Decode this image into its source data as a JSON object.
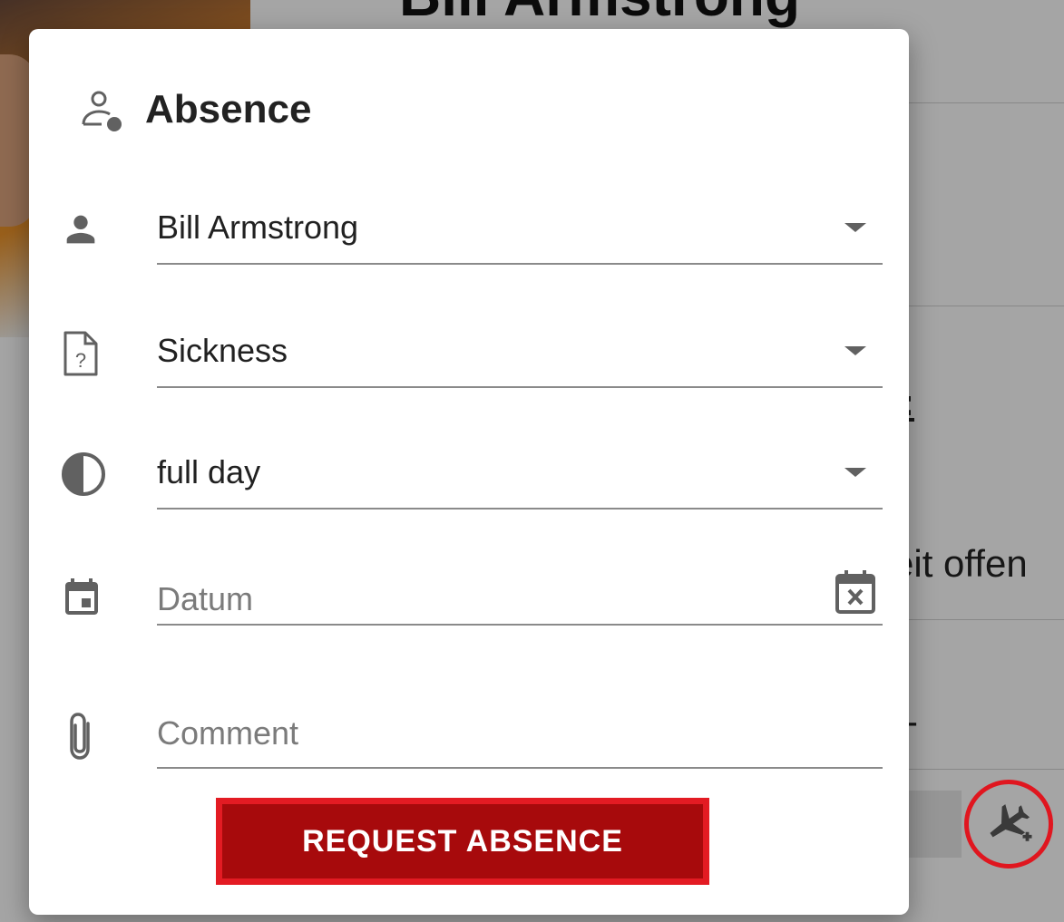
{
  "background": {
    "person_name": "Bill Armstrong",
    "partial_label_1": "t:",
    "partial_label_2": "t",
    "partial_label_3": "eit offen",
    "partial_label_4": "-"
  },
  "dialog": {
    "title": "Absence",
    "title_icon": "person-status-icon",
    "fields": {
      "employee": {
        "icon": "person-icon",
        "value": "Bill Armstrong"
      },
      "absence_type": {
        "icon": "file-question-icon",
        "value": "Sickness"
      },
      "duration": {
        "icon": "half-circle-icon",
        "value": "full day"
      },
      "date": {
        "icon": "calendar-icon",
        "placeholder": "Datum",
        "clear_icon": "calendar-clear-icon"
      },
      "comment": {
        "icon": "paperclip-icon",
        "placeholder": "Comment"
      }
    },
    "submit_label": "REQUEST ABSENCE"
  },
  "fab": {
    "icon": "airplane-add-icon"
  },
  "colors": {
    "button_bg": "#a70a0c",
    "button_border": "#e31b23",
    "highlight_ring": "#e0161f",
    "icon_gray": "#616161"
  }
}
